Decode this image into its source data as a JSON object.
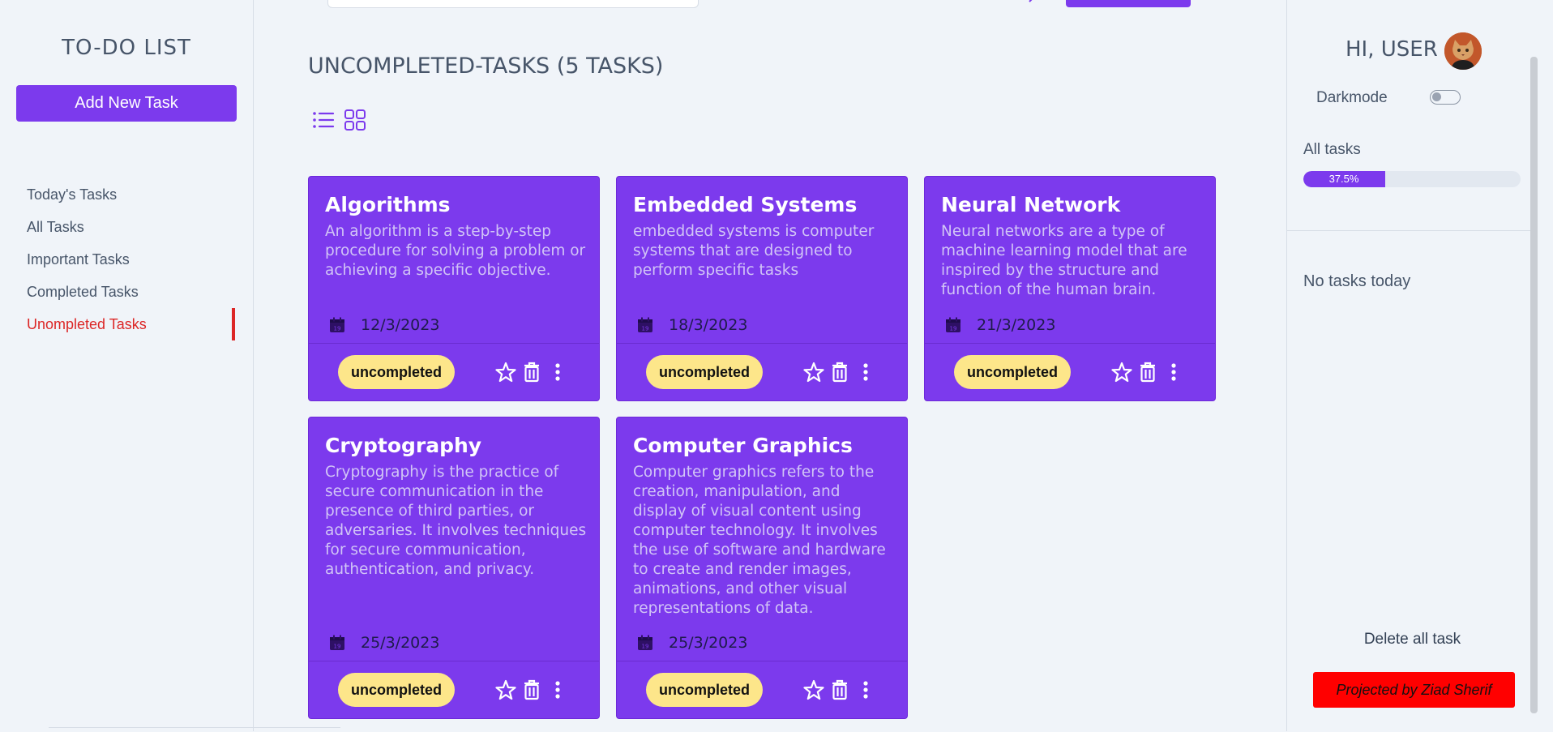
{
  "sidebar": {
    "title": "TO-DO LIST",
    "add_button": "Add New Task",
    "nav": [
      {
        "label": "Today's Tasks",
        "active": false
      },
      {
        "label": "All Tasks",
        "active": false
      },
      {
        "label": "Important Tasks",
        "active": false
      },
      {
        "label": "Completed Tasks",
        "active": false
      },
      {
        "label": "Unompleted Tasks",
        "active": true
      }
    ]
  },
  "main": {
    "title": "UNCOMPLETED-TASKS (5 TASKS)",
    "tasks": [
      {
        "title": "Algorithms",
        "description": "An algorithm is a step-by-step procedure for solving a problem or achieving a specific objective.",
        "date": "12/3/2023",
        "status": "uncompleted"
      },
      {
        "title": "Embedded Systems",
        "description": "embedded systems is computer systems that are designed to perform specific tasks",
        "date": "18/3/2023",
        "status": "uncompleted"
      },
      {
        "title": "Neural Network",
        "description": "Neural networks are a type of machine learning model that are inspired by the structure and function of the human brain.",
        "date": "21/3/2023",
        "status": "uncompleted"
      },
      {
        "title": "Cryptography",
        "description": "Cryptography is the practice of secure communication in the presence of third parties, or adversaries. It involves techniques for secure communication, authentication, and privacy.",
        "date": "25/3/2023",
        "status": "uncompleted"
      },
      {
        "title": "Computer Graphics",
        "description": "Computer graphics refers to the creation, manipulation, and display of visual content using computer technology. It involves the use of software and hardware to create and render images, animations, and other visual representations of data.",
        "date": "25/3/2023",
        "status": "uncompleted"
      }
    ]
  },
  "right": {
    "greeting": "HI, USER",
    "darkmode_label": "Darkmode",
    "darkmode_on": false,
    "all_tasks_label": "All tasks",
    "progress_percent": 37.5,
    "progress_text": "37.5%",
    "no_tasks": "No tasks today",
    "delete_all": "Delete all task",
    "credit": "Projected by Ziad Sherif"
  },
  "colors": {
    "accent": "#7c3aed",
    "badge": "#fde68a",
    "active_nav": "#dc2626",
    "credit_bg": "#ff0000"
  }
}
